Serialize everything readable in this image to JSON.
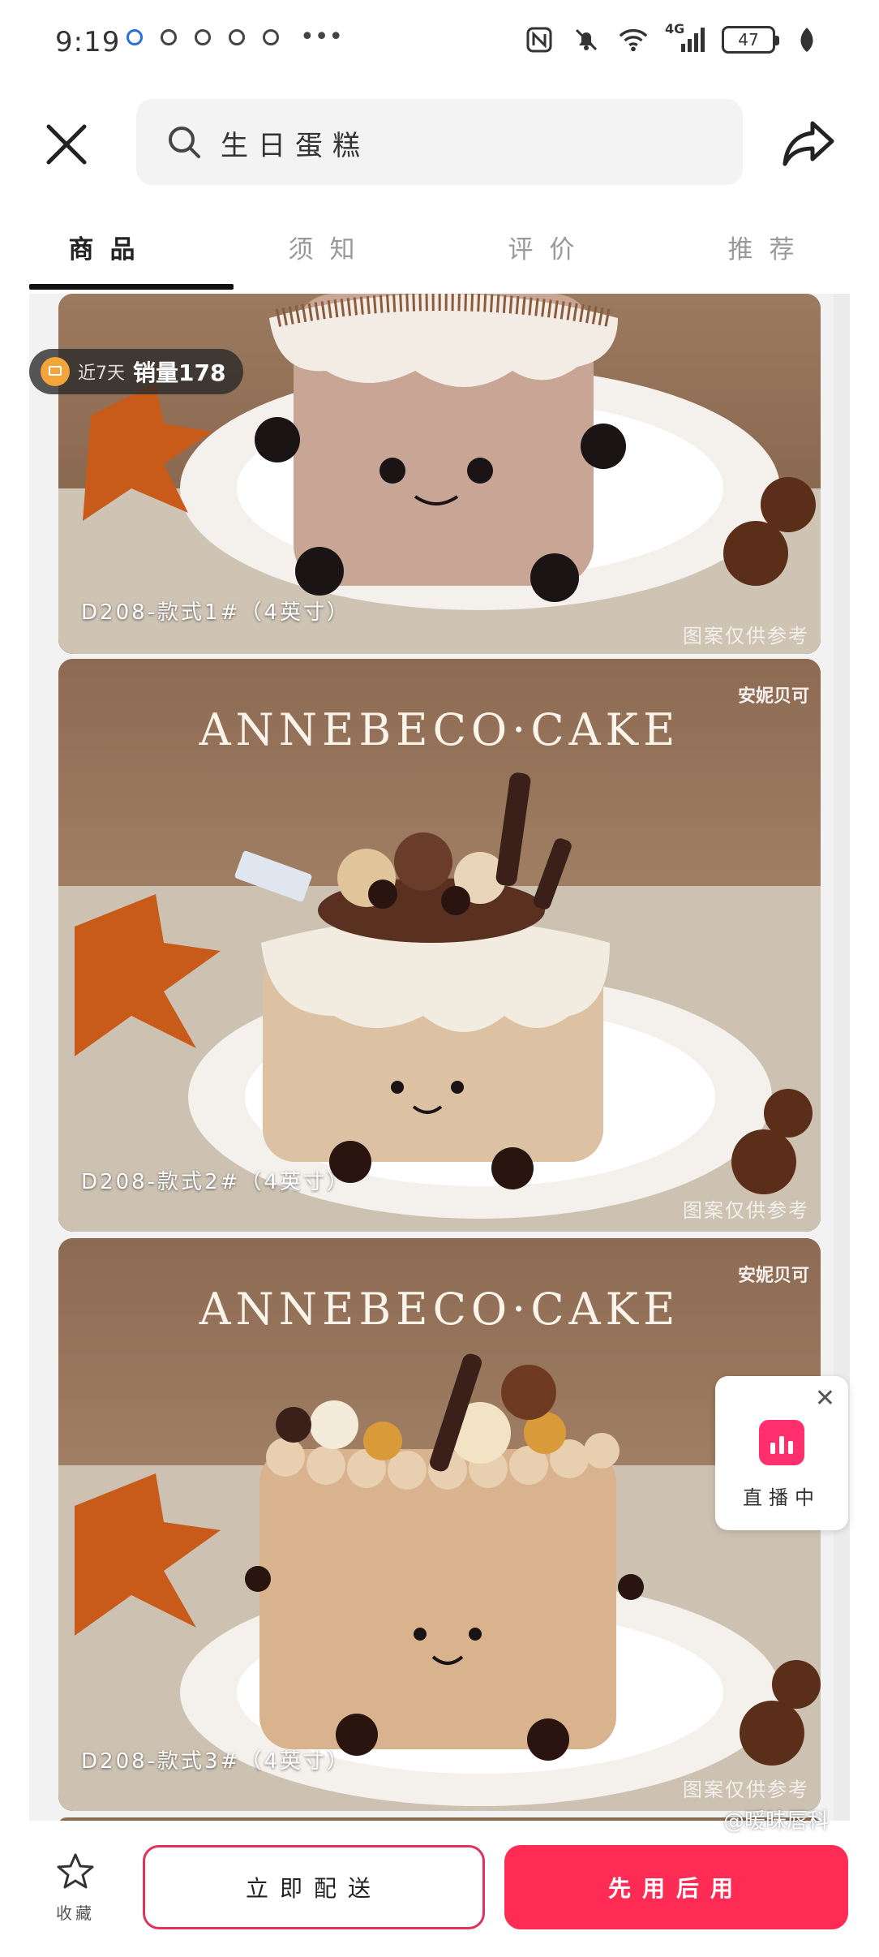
{
  "status_bar": {
    "time": "9:19",
    "network": "4G",
    "battery": "47"
  },
  "header": {
    "search_text": "生日蛋糕"
  },
  "tabs": [
    {
      "label": "商品"
    },
    {
      "label": "须知"
    },
    {
      "label": "评价"
    },
    {
      "label": "推荐"
    }
  ],
  "badge": {
    "prefix": "近7天",
    "label": "销量178"
  },
  "cards": [
    {
      "brand": "",
      "caption": "D208-款式1#（4英寸）",
      "watermark": "图案仅供参考"
    },
    {
      "brand": "ANNEBECO·CAKE",
      "logo": "安妮贝可",
      "caption": "D208-款式2#（4英寸）",
      "watermark": "图案仅供参考"
    },
    {
      "brand": "ANNEBECO·CAKE",
      "logo": "安妮贝可",
      "caption": "D208-款式3#（4英寸）",
      "watermark": "图案仅供参考"
    }
  ],
  "live": {
    "label": "直播中"
  },
  "bottom_bar": {
    "favorite_label": "收藏",
    "deliver_label": "立即配送",
    "pay_label": "先用后用"
  },
  "watermark_weibo": "@暖昧唇科",
  "colors": {
    "accent": "#fe2c55",
    "outline": "#e0325b"
  }
}
